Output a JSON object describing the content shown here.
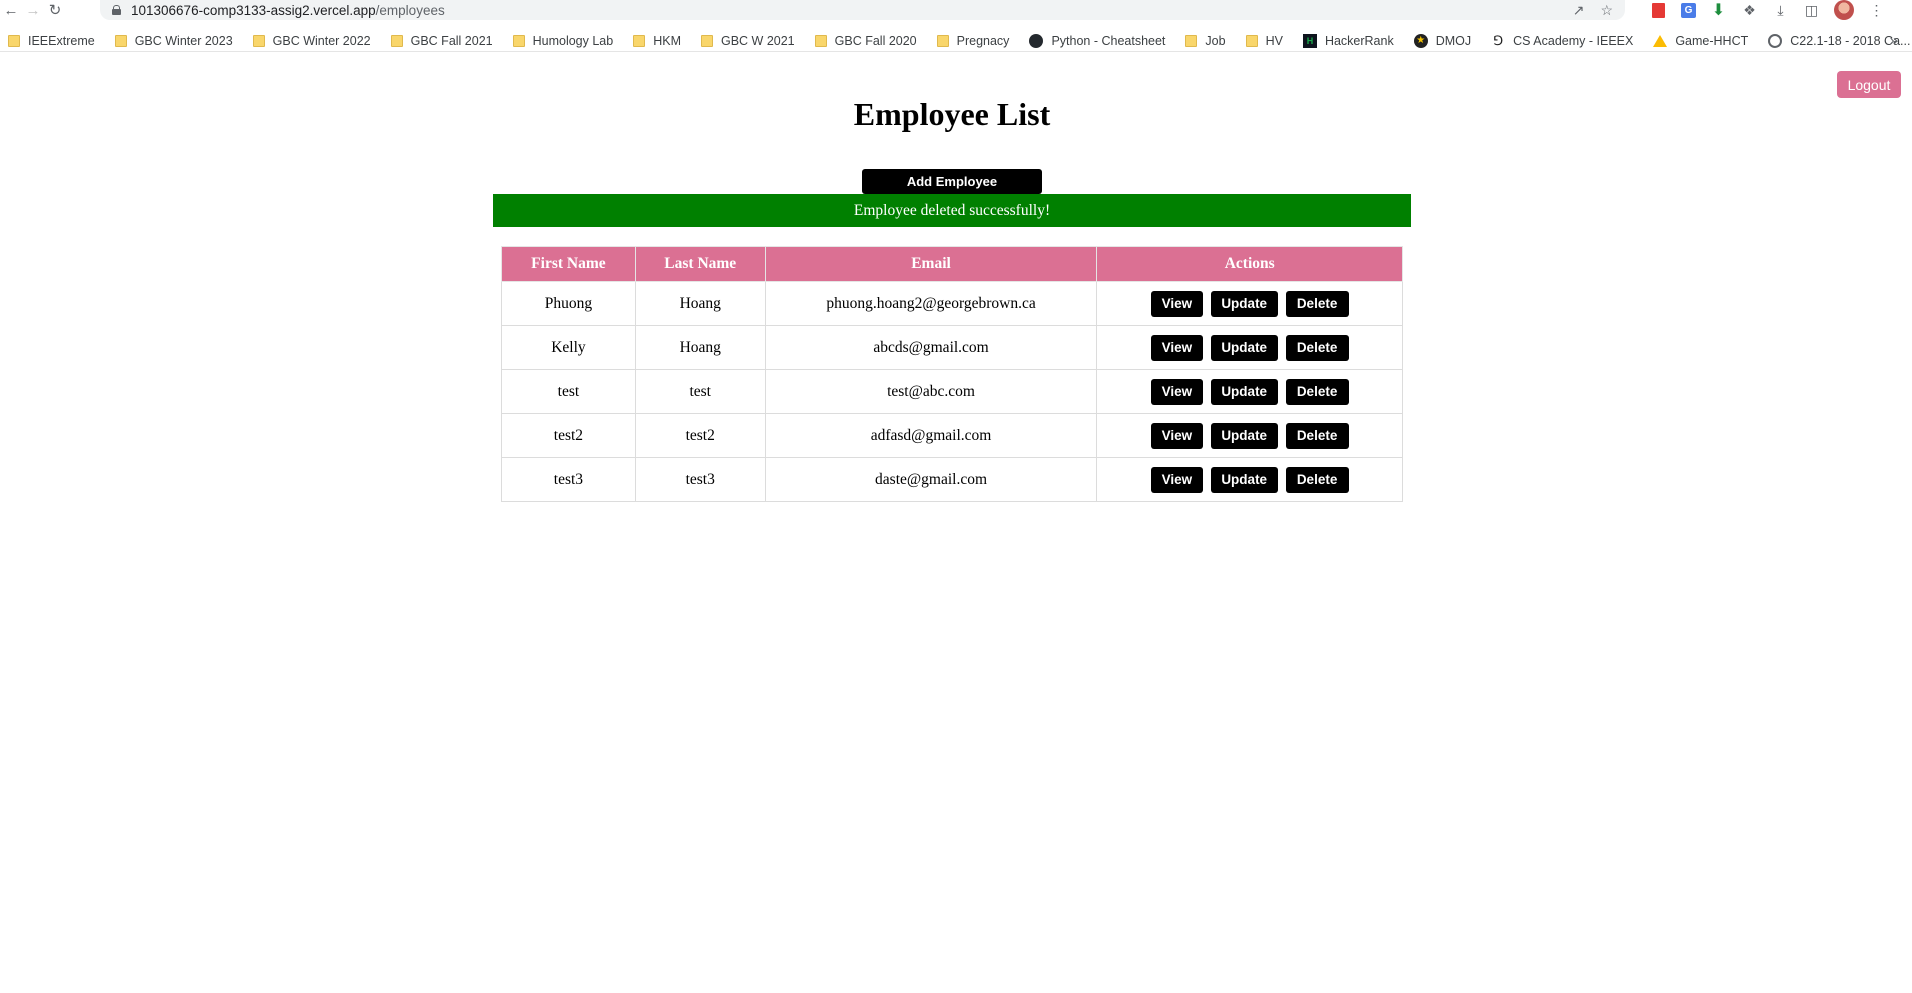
{
  "browser": {
    "url_host": "101306676-comp3133-assig2.vercel.app",
    "url_path": "/employees",
    "bookmarks": [
      {
        "label": "IEEExtreme",
        "icon": "folder-icon"
      },
      {
        "label": "GBC Winter 2023",
        "icon": "folder-icon"
      },
      {
        "label": "GBC Winter 2022",
        "icon": "folder-icon"
      },
      {
        "label": "GBC Fall 2021",
        "icon": "folder-icon"
      },
      {
        "label": "Humology Lab",
        "icon": "folder-icon"
      },
      {
        "label": "HKM",
        "icon": "folder-icon"
      },
      {
        "label": "GBC W 2021",
        "icon": "folder-icon"
      },
      {
        "label": "GBC Fall 2020",
        "icon": "folder-icon"
      },
      {
        "label": "Pregnacy",
        "icon": "folder-icon"
      },
      {
        "label": "Python - Cheatsheet",
        "icon": "github-icon"
      },
      {
        "label": "Job",
        "icon": "folder-icon"
      },
      {
        "label": "HV",
        "icon": "folder-icon"
      },
      {
        "label": "HackerRank",
        "icon": "hackerrank-icon"
      },
      {
        "label": "DMOJ",
        "icon": "dmoj-icon"
      },
      {
        "label": "CS Academy - IEEEX",
        "icon": "csacademy-icon"
      },
      {
        "label": "Game-HHCT",
        "icon": "drive-icon"
      },
      {
        "label": "C22.1-18 - 2018 Ca...",
        "icon": "globe-icon"
      }
    ]
  },
  "header": {
    "logout_label": "Logout",
    "title": "Employee List",
    "add_label": "Add Employee"
  },
  "banner": {
    "message": "Employee deleted successfully!",
    "color": "#008000"
  },
  "table": {
    "headers": [
      "First Name",
      "Last Name",
      "Email",
      "Actions"
    ],
    "header_color": "#db7093",
    "rows": [
      {
        "first": "Phuong",
        "last": "Hoang",
        "email": "phuong.hoang2@georgebrown.ca"
      },
      {
        "first": "Kelly",
        "last": "Hoang",
        "email": "abcds@gmail.com"
      },
      {
        "first": "test",
        "last": "test",
        "email": "test@abc.com"
      },
      {
        "first": "test2",
        "last": "test2",
        "email": "adfasd@gmail.com"
      },
      {
        "first": "test3",
        "last": "test3",
        "email": "daste@gmail.com"
      }
    ],
    "actions": {
      "view": "View",
      "update": "Update",
      "delete": "Delete"
    }
  }
}
